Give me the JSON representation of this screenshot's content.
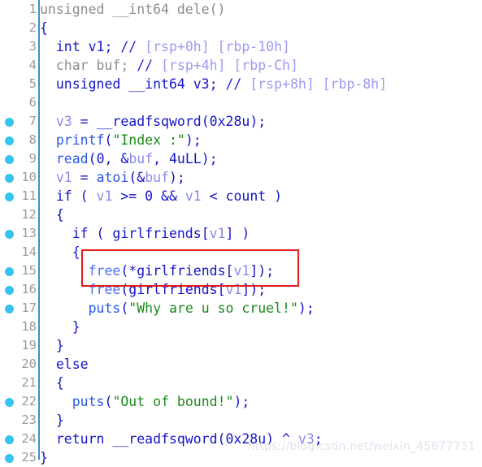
{
  "app": {
    "view_name": "pseudocode-decompiler-view",
    "background": "#ffffff",
    "gutter_rule_color": "#3a8fd0",
    "breakpoint_color": "#35c3f0",
    "lineno_color": "#9a9a9a",
    "highlight_box_color": "#e01b1b"
  },
  "watermark": {
    "text": "https://blog.csdn.net/weixin_45677731"
  },
  "highlight": {
    "name": "double-free-highlight-box",
    "first_line": 15,
    "last_line": 16,
    "color": "#e01b1b"
  },
  "code": {
    "language": "c-pseudocode",
    "lines": [
      {
        "number": "1",
        "breakpoint": false,
        "plain": "unsigned __int64 dele()",
        "tokens": [
          {
            "text": "unsigned __int64 dele()",
            "cls": "t-gray"
          }
        ]
      },
      {
        "number": "2",
        "breakpoint": false,
        "plain": "{",
        "tokens": [
          {
            "text": "{",
            "cls": "t-plain"
          }
        ]
      },
      {
        "number": "3",
        "breakpoint": false,
        "plain": "  int v1; // [rsp+0h] [rbp-10h]",
        "tokens": [
          {
            "text": "  int v1; ",
            "cls": "t-kw"
          },
          {
            "text": "//",
            "cls": "t-cmtsl"
          },
          {
            "text": " [rsp+0h] [rbp-10h]",
            "cls": "t-cmt"
          }
        ]
      },
      {
        "number": "4",
        "breakpoint": false,
        "plain": "  char buf; // [rsp+4h] [rbp-Ch]",
        "tokens": [
          {
            "text": "  char buf; ",
            "cls": "t-gray"
          },
          {
            "text": "//",
            "cls": "t-cmtsl"
          },
          {
            "text": " [rsp+4h] [rbp-Ch]",
            "cls": "t-cmt"
          }
        ]
      },
      {
        "number": "5",
        "breakpoint": false,
        "plain": "  unsigned __int64 v3; // [rsp+8h] [rbp-8h]",
        "tokens": [
          {
            "text": "  unsigned __int64 v3; ",
            "cls": "t-kw"
          },
          {
            "text": "//",
            "cls": "t-cmtsl"
          },
          {
            "text": " [rsp+8h] [rbp-8h]",
            "cls": "t-cmt"
          }
        ]
      },
      {
        "number": "6",
        "breakpoint": false,
        "plain": "",
        "tokens": []
      },
      {
        "number": "7",
        "breakpoint": true,
        "plain": "  v3 = __readfsqword(0x28u);",
        "tokens": [
          {
            "text": "  ",
            "cls": "t-plain"
          },
          {
            "text": "v3",
            "cls": "t-var"
          },
          {
            "text": " = ",
            "cls": "t-plain"
          },
          {
            "text": "__readfsqword",
            "cls": "t-kw"
          },
          {
            "text": "(",
            "cls": "t-plain"
          },
          {
            "text": "0x28u",
            "cls": "t-num"
          },
          {
            "text": ");",
            "cls": "t-plain"
          }
        ]
      },
      {
        "number": "8",
        "breakpoint": true,
        "plain": "  printf(\"Index :\");",
        "tokens": [
          {
            "text": "  ",
            "cls": "t-plain"
          },
          {
            "text": "printf",
            "cls": "t-fn"
          },
          {
            "text": "(",
            "cls": "t-plain"
          },
          {
            "text": "\"Index :\"",
            "cls": "t-str"
          },
          {
            "text": ");",
            "cls": "t-plain"
          }
        ]
      },
      {
        "number": "9",
        "breakpoint": true,
        "plain": "  read(0, &buf, 4uLL);",
        "tokens": [
          {
            "text": "  ",
            "cls": "t-plain"
          },
          {
            "text": "read",
            "cls": "t-fn"
          },
          {
            "text": "(",
            "cls": "t-plain"
          },
          {
            "text": "0",
            "cls": "t-num"
          },
          {
            "text": ", &",
            "cls": "t-plain"
          },
          {
            "text": "buf",
            "cls": "t-var"
          },
          {
            "text": ", ",
            "cls": "t-plain"
          },
          {
            "text": "4uLL",
            "cls": "t-num"
          },
          {
            "text": ");",
            "cls": "t-plain"
          }
        ]
      },
      {
        "number": "10",
        "breakpoint": true,
        "plain": "  v1 = atoi(&buf);",
        "tokens": [
          {
            "text": "  ",
            "cls": "t-plain"
          },
          {
            "text": "v1",
            "cls": "t-var"
          },
          {
            "text": " = ",
            "cls": "t-plain"
          },
          {
            "text": "atoi",
            "cls": "t-fn"
          },
          {
            "text": "(&",
            "cls": "t-plain"
          },
          {
            "text": "buf",
            "cls": "t-var"
          },
          {
            "text": ");",
            "cls": "t-plain"
          }
        ]
      },
      {
        "number": "11",
        "breakpoint": true,
        "plain": "  if ( v1 >= 0 && v1 < count )",
        "tokens": [
          {
            "text": "  if ( ",
            "cls": "t-plain"
          },
          {
            "text": "v1",
            "cls": "t-var"
          },
          {
            "text": " >= ",
            "cls": "t-plain"
          },
          {
            "text": "0",
            "cls": "t-num"
          },
          {
            "text": " && ",
            "cls": "t-plain"
          },
          {
            "text": "v1",
            "cls": "t-var"
          },
          {
            "text": " < ",
            "cls": "t-plain"
          },
          {
            "text": "count",
            "cls": "t-glob"
          },
          {
            "text": " )",
            "cls": "t-plain"
          }
        ]
      },
      {
        "number": "12",
        "breakpoint": false,
        "plain": "  {",
        "tokens": [
          {
            "text": "  {",
            "cls": "t-plain"
          }
        ]
      },
      {
        "number": "13",
        "breakpoint": true,
        "plain": "    if ( girlfriends[v1] )",
        "tokens": [
          {
            "text": "    if ( ",
            "cls": "t-plain"
          },
          {
            "text": "girlfriends",
            "cls": "t-glob"
          },
          {
            "text": "[",
            "cls": "t-plain"
          },
          {
            "text": "v1",
            "cls": "t-var"
          },
          {
            "text": "] )",
            "cls": "t-plain"
          }
        ]
      },
      {
        "number": "14",
        "breakpoint": false,
        "plain": "    {",
        "tokens": [
          {
            "text": "    {",
            "cls": "t-plain"
          }
        ]
      },
      {
        "number": "15",
        "breakpoint": true,
        "plain": "      free(*girlfriends[v1]);",
        "tokens": [
          {
            "text": "      ",
            "cls": "t-plain"
          },
          {
            "text": "free",
            "cls": "t-fn2"
          },
          {
            "text": "(*",
            "cls": "t-plain"
          },
          {
            "text": "girlfriends",
            "cls": "t-glob"
          },
          {
            "text": "[",
            "cls": "t-plain"
          },
          {
            "text": "v1",
            "cls": "t-var"
          },
          {
            "text": "]);",
            "cls": "t-plain"
          }
        ]
      },
      {
        "number": "16",
        "breakpoint": true,
        "plain": "      free(girlfriends[v1]);",
        "tokens": [
          {
            "text": "      ",
            "cls": "t-plain"
          },
          {
            "text": "free",
            "cls": "t-fn2"
          },
          {
            "text": "(",
            "cls": "t-plain"
          },
          {
            "text": "girlfriends",
            "cls": "t-glob"
          },
          {
            "text": "[",
            "cls": "t-plain"
          },
          {
            "text": "v1",
            "cls": "t-var"
          },
          {
            "text": "]);",
            "cls": "t-plain"
          }
        ]
      },
      {
        "number": "17",
        "breakpoint": true,
        "plain": "      puts(\"Why are u so cruel!\");",
        "tokens": [
          {
            "text": "      ",
            "cls": "t-plain"
          },
          {
            "text": "puts",
            "cls": "t-fn"
          },
          {
            "text": "(",
            "cls": "t-plain"
          },
          {
            "text": "\"Why are u so cruel!\"",
            "cls": "t-str"
          },
          {
            "text": ");",
            "cls": "t-plain"
          }
        ]
      },
      {
        "number": "18",
        "breakpoint": false,
        "plain": "    }",
        "tokens": [
          {
            "text": "    }",
            "cls": "t-plain"
          }
        ]
      },
      {
        "number": "19",
        "breakpoint": false,
        "plain": "  }",
        "tokens": [
          {
            "text": "  }",
            "cls": "t-plain"
          }
        ]
      },
      {
        "number": "20",
        "breakpoint": false,
        "plain": "  else",
        "tokens": [
          {
            "text": "  else",
            "cls": "t-plain"
          }
        ]
      },
      {
        "number": "21",
        "breakpoint": false,
        "plain": "  {",
        "tokens": [
          {
            "text": "  {",
            "cls": "t-plain"
          }
        ]
      },
      {
        "number": "22",
        "breakpoint": true,
        "plain": "    puts(\"Out of bound!\");",
        "tokens": [
          {
            "text": "    ",
            "cls": "t-plain"
          },
          {
            "text": "puts",
            "cls": "t-fn"
          },
          {
            "text": "(",
            "cls": "t-plain"
          },
          {
            "text": "\"Out of bound!\"",
            "cls": "t-str"
          },
          {
            "text": ");",
            "cls": "t-plain"
          }
        ]
      },
      {
        "number": "23",
        "breakpoint": false,
        "plain": "  }",
        "tokens": [
          {
            "text": "  }",
            "cls": "t-plain"
          }
        ]
      },
      {
        "number": "24",
        "breakpoint": true,
        "plain": "  return __readfsqword(0x28u) ^ v3;",
        "tokens": [
          {
            "text": "  return ",
            "cls": "t-plain"
          },
          {
            "text": "__readfsqword",
            "cls": "t-kw"
          },
          {
            "text": "(",
            "cls": "t-plain"
          },
          {
            "text": "0x28u",
            "cls": "t-num"
          },
          {
            "text": ") ^ ",
            "cls": "t-plain"
          },
          {
            "text": "v3",
            "cls": "t-var"
          },
          {
            "text": ";",
            "cls": "t-plain"
          }
        ]
      },
      {
        "number": "25",
        "breakpoint": true,
        "plain": "}",
        "tokens": [
          {
            "text": "}",
            "cls": "t-plain"
          }
        ]
      }
    ]
  }
}
